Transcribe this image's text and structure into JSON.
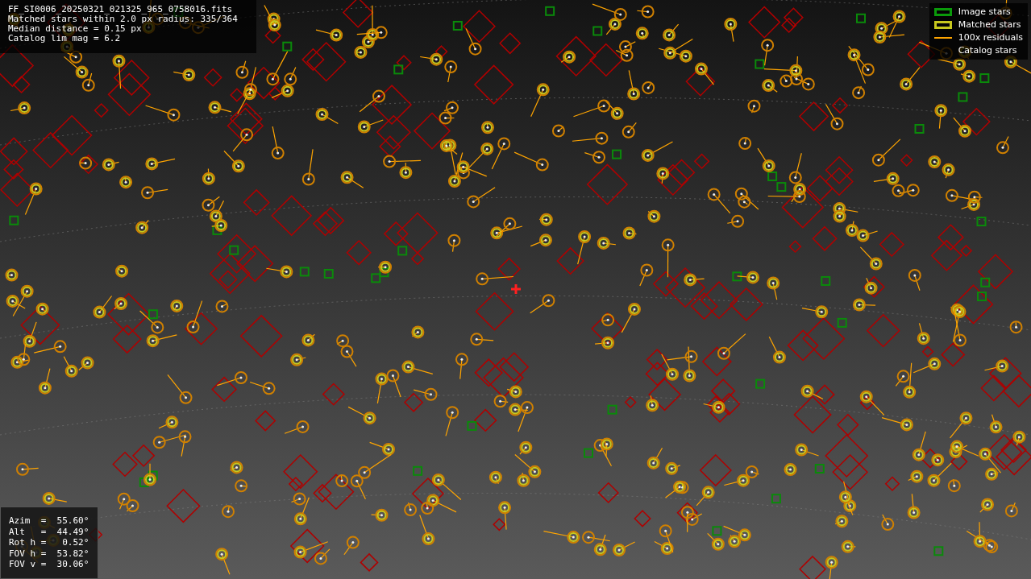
{
  "file_info": {
    "lines": [
      "FF_SI0006_20250321_021325_965_0758016.fits",
      "Matched stars within 2.0 px radius: 335/364",
      "Median distance = 0.15 px",
      "Catalog lim mag = 6.2"
    ]
  },
  "legend": {
    "items": [
      {
        "label": "Image stars",
        "kind": "box",
        "color": "#0a9a0a"
      },
      {
        "label": "Matched stars",
        "kind": "box",
        "color": "#c8c81e"
      },
      {
        "label": "100x residuals",
        "kind": "line",
        "color": "#ffa500"
      },
      {
        "label": "Catalog stars",
        "kind": "blank"
      }
    ]
  },
  "pointing": {
    "rows": [
      "Azim  =  55.60°",
      "Alt   =  44.49°",
      "Rot h =   0.52°",
      "FOV h =  53.82°",
      "FOV v =  30.06°"
    ]
  }
}
